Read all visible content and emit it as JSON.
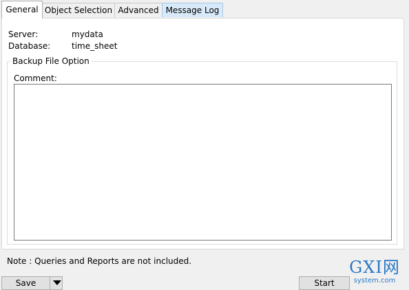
{
  "tabs": [
    {
      "label": "General",
      "state": "active"
    },
    {
      "label": "Object Selection",
      "state": "normal"
    },
    {
      "label": "Advanced",
      "state": "normal"
    },
    {
      "label": "Message Log",
      "state": "hover"
    }
  ],
  "info": {
    "server_label": "Server:",
    "server_value": "mydata",
    "database_label": "Database:",
    "database_value": "time_sheet"
  },
  "backup_group": {
    "title": "Backup File Option",
    "comment_label": "Comment:",
    "comment_value": ""
  },
  "note": "Note : Queries and Reports are not included.",
  "buttons": {
    "save": "Save",
    "start": "Start"
  },
  "watermark": {
    "main": "GXI网",
    "sub": "system.com"
  },
  "colors": {
    "tab_hover": "#d8eaf9",
    "watermark": "#2a78c6"
  }
}
